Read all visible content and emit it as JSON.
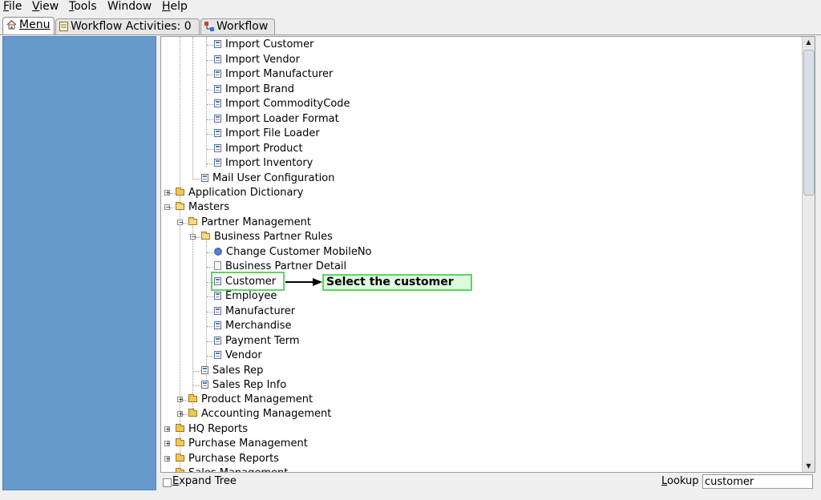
{
  "menubar": {
    "file": "File",
    "view": "View",
    "tools": "Tools",
    "window": "Window",
    "help": "Help"
  },
  "tabs": [
    {
      "label": "Menu",
      "icon": "home-icon"
    },
    {
      "label": "Workflow Activities: 0",
      "icon": "list-icon"
    },
    {
      "label": "Workflow",
      "icon": "workflow-icon"
    }
  ],
  "tree": {
    "import_customer": "Import Customer",
    "import_vendor": "Import Vendor",
    "import_manufacturer": "Import Manufacturer",
    "import_brand": "Import Brand",
    "import_commoditycode": "Import CommodityCode",
    "import_loader_format": "Import Loader Format",
    "import_file_loader": "Import File Loader",
    "import_product": "Import Product",
    "import_inventory": "Import Inventory",
    "mail_user_configuration": "Mail User Configuration",
    "application_dictionary": "Application Dictionary",
    "masters": "Masters",
    "partner_management": "Partner Management",
    "business_partner_rules": "Business Partner Rules",
    "change_customer_mobileno": "Change Customer MobileNo",
    "business_partner_detail": "Business Partner Detail",
    "customer": "Customer",
    "employee": "Employee",
    "manufacturer": "Manufacturer",
    "merchandise": "Merchandise",
    "payment_term": "Payment Term",
    "vendor": "Vendor",
    "sales_rep": "Sales Rep",
    "sales_rep_info": "Sales Rep Info",
    "product_management": "Product Management",
    "accounting_management": "Accounting Management",
    "hq_reports": "HQ Reports",
    "purchase_management": "Purchase Management",
    "purchase_reports": "Purchase Reports",
    "sales_management": "Sales Management"
  },
  "annotation": {
    "callout": "Select the customer",
    "color": "#5fd35f"
  },
  "bottom": {
    "expand_tree": "Expand Tree",
    "lookup_label": "Lookup",
    "lookup_value": "customer"
  }
}
